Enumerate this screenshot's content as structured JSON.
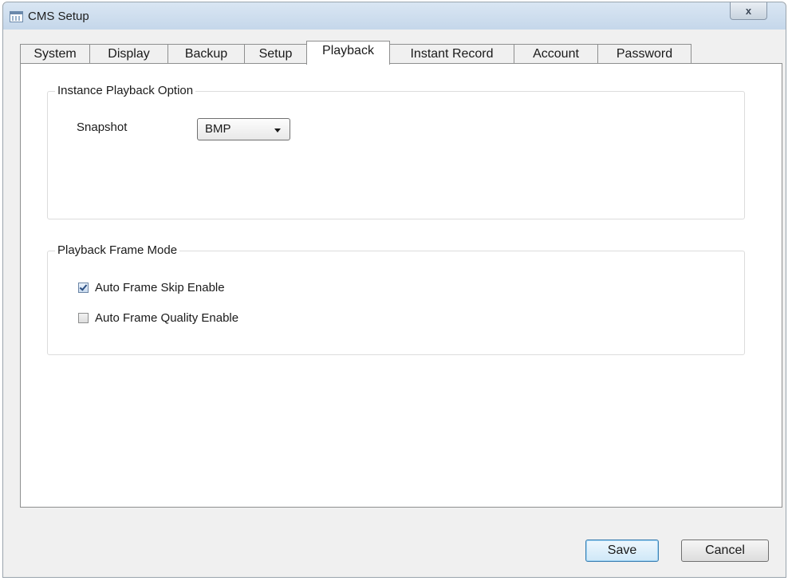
{
  "window": {
    "title": "CMS Setup",
    "close_glyph": "x"
  },
  "tabs": [
    {
      "label": "System",
      "active": false
    },
    {
      "label": "Display",
      "active": false
    },
    {
      "label": "Backup",
      "active": false
    },
    {
      "label": "Setup",
      "active": false
    },
    {
      "label": "Playback",
      "active": true
    },
    {
      "label": "Instant Record",
      "active": false
    },
    {
      "label": "Account",
      "active": false
    },
    {
      "label": "Password",
      "active": false
    }
  ],
  "playback_option": {
    "legend": "Instance Playback Option",
    "snapshot_label": "Snapshot",
    "snapshot_value": "BMP"
  },
  "frame_mode": {
    "legend": "Playback Frame Mode",
    "options": [
      {
        "label": "Auto Frame Skip Enable",
        "checked": true
      },
      {
        "label": "Auto Frame Quality Enable",
        "checked": false
      }
    ]
  },
  "buttons": {
    "save": "Save",
    "cancel": "Cancel"
  },
  "icons": {
    "app": "grid-app-icon",
    "close": "close-icon",
    "dropdown": "chevron-down-icon",
    "check": "check-icon"
  }
}
